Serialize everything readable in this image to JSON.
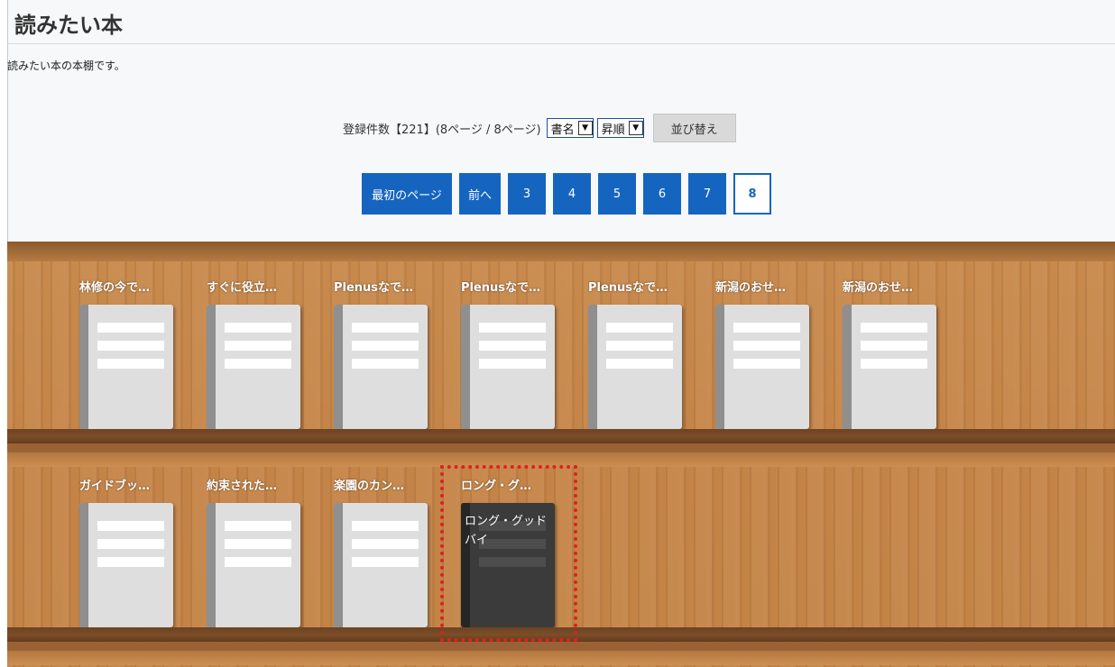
{
  "page": {
    "title": "読みたい本",
    "description": "読みたい本の本棚です。"
  },
  "controls": {
    "count_text": "登録件数【221】(8ページ / 8ページ)",
    "sort_field": "書名",
    "sort_order": "昇順",
    "sort_button": "並び替え"
  },
  "pagination": {
    "first": "最初のページ",
    "prev": "前へ",
    "pages": [
      "3",
      "4",
      "5",
      "6",
      "7",
      "8"
    ],
    "current": "8"
  },
  "shelves": [
    {
      "books": [
        {
          "label": "林修の今で…"
        },
        {
          "label": "すぐに役立…"
        },
        {
          "label": "Plenusなで…"
        },
        {
          "label": "Plenusなで…"
        },
        {
          "label": "Plenusなで…"
        },
        {
          "label": "新潟のおせ…"
        },
        {
          "label": "新潟のおせ…"
        }
      ]
    },
    {
      "books": [
        {
          "label": "ガイドブッ…"
        },
        {
          "label": "約束された…"
        },
        {
          "label": "楽園のカン…"
        },
        {
          "label": "ロング・グ…",
          "cover_text": "ロング・グッドバイ",
          "highlighted": true
        }
      ]
    }
  ],
  "colors": {
    "pager_blue": "#1565c0",
    "highlight": "#e02020",
    "wood": "#c88a4d"
  }
}
